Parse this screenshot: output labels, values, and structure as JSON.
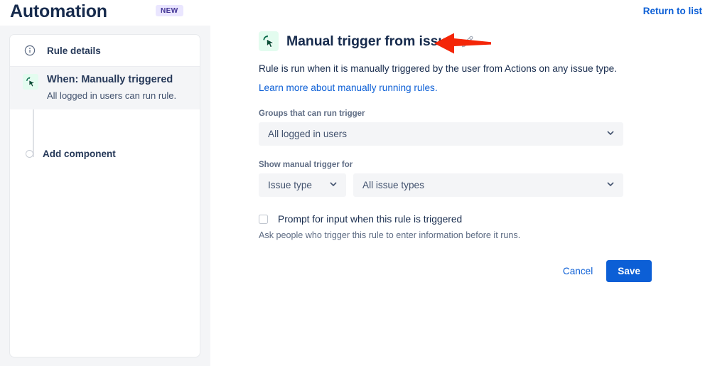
{
  "header": {
    "title": "Automation",
    "badge": "NEW",
    "return_link": "Return to list"
  },
  "sidebar": {
    "rule_details": {
      "label": "Rule details",
      "icon": "info-circle-icon"
    },
    "steps": [
      {
        "title": "When: Manually triggered",
        "subtitle": "All logged in users can run rule.",
        "icon": "manual-trigger-cursor-icon"
      }
    ],
    "add_component": {
      "label": "Add component",
      "icon": "empty-circle-icon"
    }
  },
  "main": {
    "icon": "manual-trigger-cursor-icon",
    "title": "Manual trigger from issue",
    "edit_icon": "pencil-icon",
    "annotation": "red-arrow-pointing-at-edit-icon",
    "description": "Rule is run when it is manually triggered by the user from Actions on any issue type.",
    "learn_more_link": "Learn more about manually running rules.",
    "groups_field": {
      "label": "Groups that can run trigger",
      "value": "All logged in users",
      "chevron": "chevron-down-icon"
    },
    "show_trigger_field": {
      "label": "Show manual trigger for",
      "type_value": "Issue type",
      "type_chevron": "chevron-down-icon",
      "scope_value": "All issue types",
      "scope_chevron": "chevron-down-icon"
    },
    "prompt_checkbox": {
      "checked": false,
      "label": "Prompt for input when this rule is triggered",
      "help": "Ask people who trigger this rule to enter information before it runs."
    },
    "buttons": {
      "cancel": "Cancel",
      "save": "Save"
    }
  },
  "colors": {
    "accent_blue": "#0c5fd6",
    "badge_bg": "#eae6ff",
    "badge_text": "#403294",
    "icon_green_bg": "#e3fcef",
    "icon_green_fg": "#006644",
    "annotation_red": "#f42608",
    "panel_gray": "#f4f5f7",
    "text_dark": "#172b4d"
  }
}
